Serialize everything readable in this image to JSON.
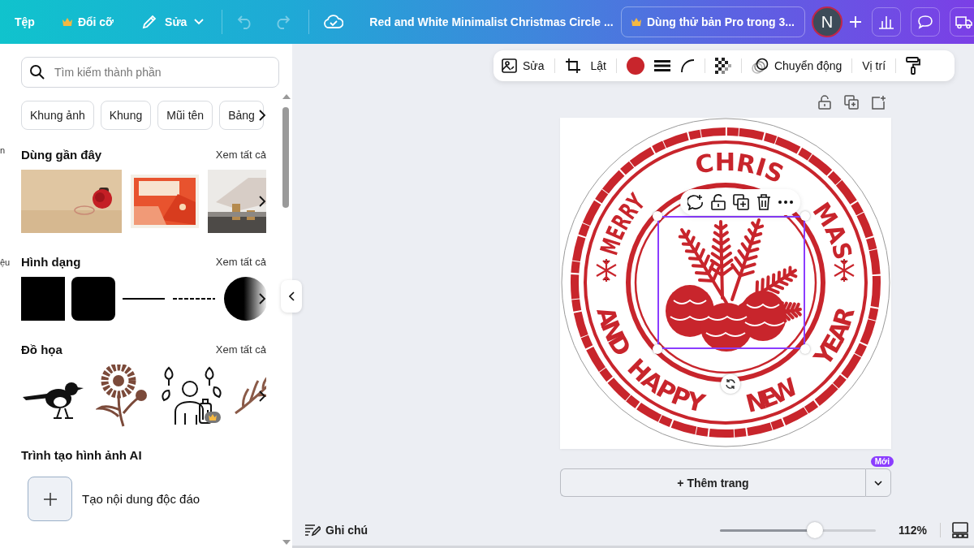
{
  "header": {
    "menu": "Tệp",
    "resize": "Đổi cỡ",
    "edit": "Sửa",
    "undo": {
      "disabled": true
    },
    "redo": {
      "disabled": true
    },
    "title": "Red and White Minimalist Christmas Circle ...",
    "pro_trial": "Dùng thử bản Pro trong 3...",
    "avatar": "N"
  },
  "element_toolbar": {
    "edit": "Sửa",
    "flip": "Lật",
    "animate": "Chuyển động",
    "position": "Vị trí"
  },
  "sidebar": {
    "rail_labels": [
      "n",
      "ệu"
    ],
    "search": {
      "placeholder": "Tìm kiếm thành phần"
    },
    "chips": [
      "Khung ảnh",
      "Khung",
      "Mũi tên",
      "Bảng"
    ],
    "sections": [
      {
        "kind": "photos",
        "title": "Dùng gần đây",
        "see_all": "Xem tất cả"
      },
      {
        "kind": "shapes",
        "title": "Hình dạng",
        "see_all": "Xem tất cả"
      },
      {
        "kind": "graphics",
        "title": "Đồ họa",
        "see_all": "Xem tất cả"
      }
    ],
    "ai_generator": {
      "title": "Trình tạo hình ảnh AI",
      "action": "Tạo nội dung độc đáo"
    }
  },
  "design": {
    "top_text": [
      "MERRY",
      "CHRIS",
      "MAS"
    ],
    "bottom_text": [
      "AND",
      "HAPPY",
      "NEW",
      "YEAR"
    ]
  },
  "add_page": {
    "label": "+ Thêm trang",
    "badge": "Mới"
  },
  "footer": {
    "notes": "Ghi chú",
    "zoom": {
      "level": 0.61
    },
    "zoom_reading": "112%"
  }
}
